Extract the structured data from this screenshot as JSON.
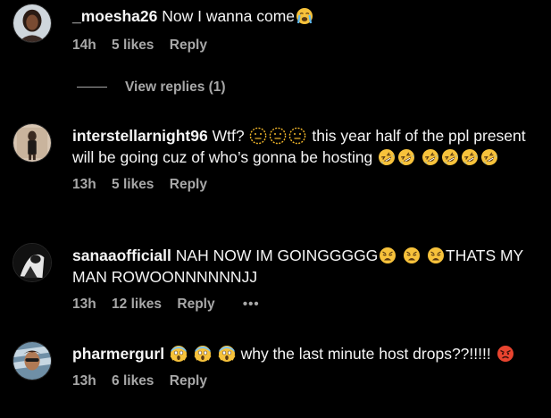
{
  "comments": [
    {
      "username": "_moesha26",
      "text": "Now I wanna come",
      "time": "14h",
      "likes": "5 likes",
      "reply": "Reply"
    },
    {
      "username": "interstellarnight96",
      "text_part1": "Wtf?",
      "text_part2": "this year half of the ppl present will be going cuz of who’s gonna be hosting",
      "time": "13h",
      "likes": "5 likes",
      "reply": "Reply"
    },
    {
      "username": "sanaaofficiall",
      "text_part1": "NAH NOW IM GOINGGGGG",
      "text_part2": "THATS MY MAN ROWOONNNNNNJJ",
      "time": "13h",
      "likes": "12 likes",
      "reply": "Reply",
      "more": "•••"
    },
    {
      "username": "pharmergurl",
      "text_part1": "why the last minute host drops??!!!!!",
      "time": "13h",
      "likes": "6 likes",
      "reply": "Reply"
    }
  ],
  "view_replies": "View replies (1)",
  "icons": {
    "comment1_trailing": "loudly-crying-face-emoji",
    "comment2_after_wtf": "face-with-open-eyes-and-hand-over-mouth-emoji",
    "comment2_trailing": "rolling-on-the-floor-laughing-emoji",
    "comment3_middle": "weary-face-emoji",
    "comment4_leading": "face-screaming-in-fear-emoji",
    "comment4_trailing": "pouting-face-emoji"
  },
  "colors": {
    "background": "#000000",
    "text": "#f5f5f5",
    "secondary": "#a8a8a8"
  }
}
